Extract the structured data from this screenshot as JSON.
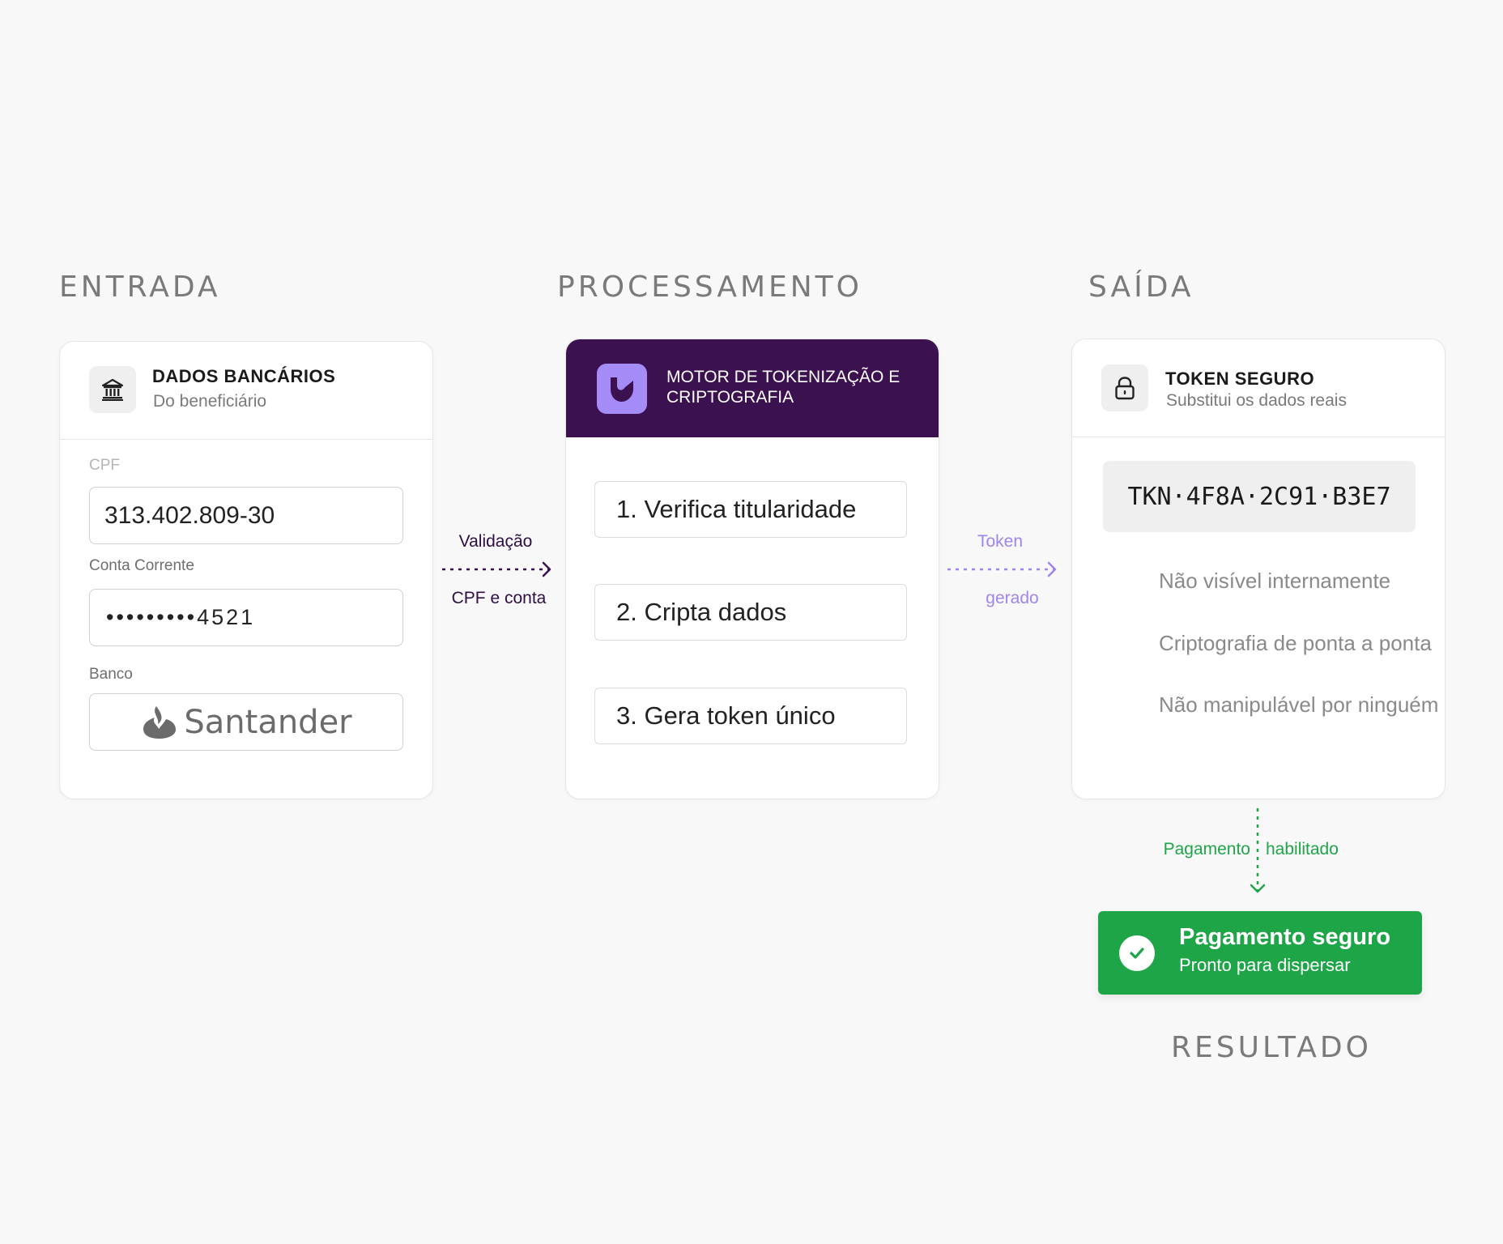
{
  "sections": {
    "entrada": "ENTRADA",
    "processamento": "PROCESSAMENTO",
    "saida": "SAÍDA",
    "resultado": "RESULTADO"
  },
  "bank_card": {
    "title": "DADOS BANCÁRIOS",
    "subtitle": "Do beneficiário",
    "icon": "bank-icon",
    "cpf_label": "CPF",
    "cpf_value": "313.402.809-30",
    "account_label": "Conta Corrente",
    "account_value": "•••••••••4521",
    "bank_label": "Banco",
    "bank_value": "Santander"
  },
  "arrow_left": {
    "top": "Validação",
    "bottom": "CPF e conta"
  },
  "engine_card": {
    "title": "MOTOR DE TOKENIZAÇÃO E CRIPTOGRAFIA",
    "icon": "shield-logo-icon",
    "accent": "#3b1150",
    "logo_color": "#a58bf6",
    "steps": [
      "1. Verifica titularidade",
      "2. Cripta dados",
      "3. Gera token único"
    ]
  },
  "arrow_right": {
    "top": "Token",
    "bottom": "gerado",
    "color": "#9f85ee"
  },
  "token_card": {
    "title": "TOKEN SEGURO",
    "subtitle": "Substitui os dados reais",
    "icon": "lock-icon",
    "token": "TKN·4F8A·2C91·B3E7",
    "features": [
      "Não visível internamente",
      "Criptografia de ponta a ponta",
      "Não manipulável por ninguém"
    ]
  },
  "arrow_down": {
    "left": "Pagamento",
    "right": "habilitado",
    "color": "#1ea548"
  },
  "result": {
    "title": "Pagamento seguro",
    "subtitle": "Pronto para dispersar",
    "icon": "check-circle-icon",
    "color": "#1ea548"
  }
}
